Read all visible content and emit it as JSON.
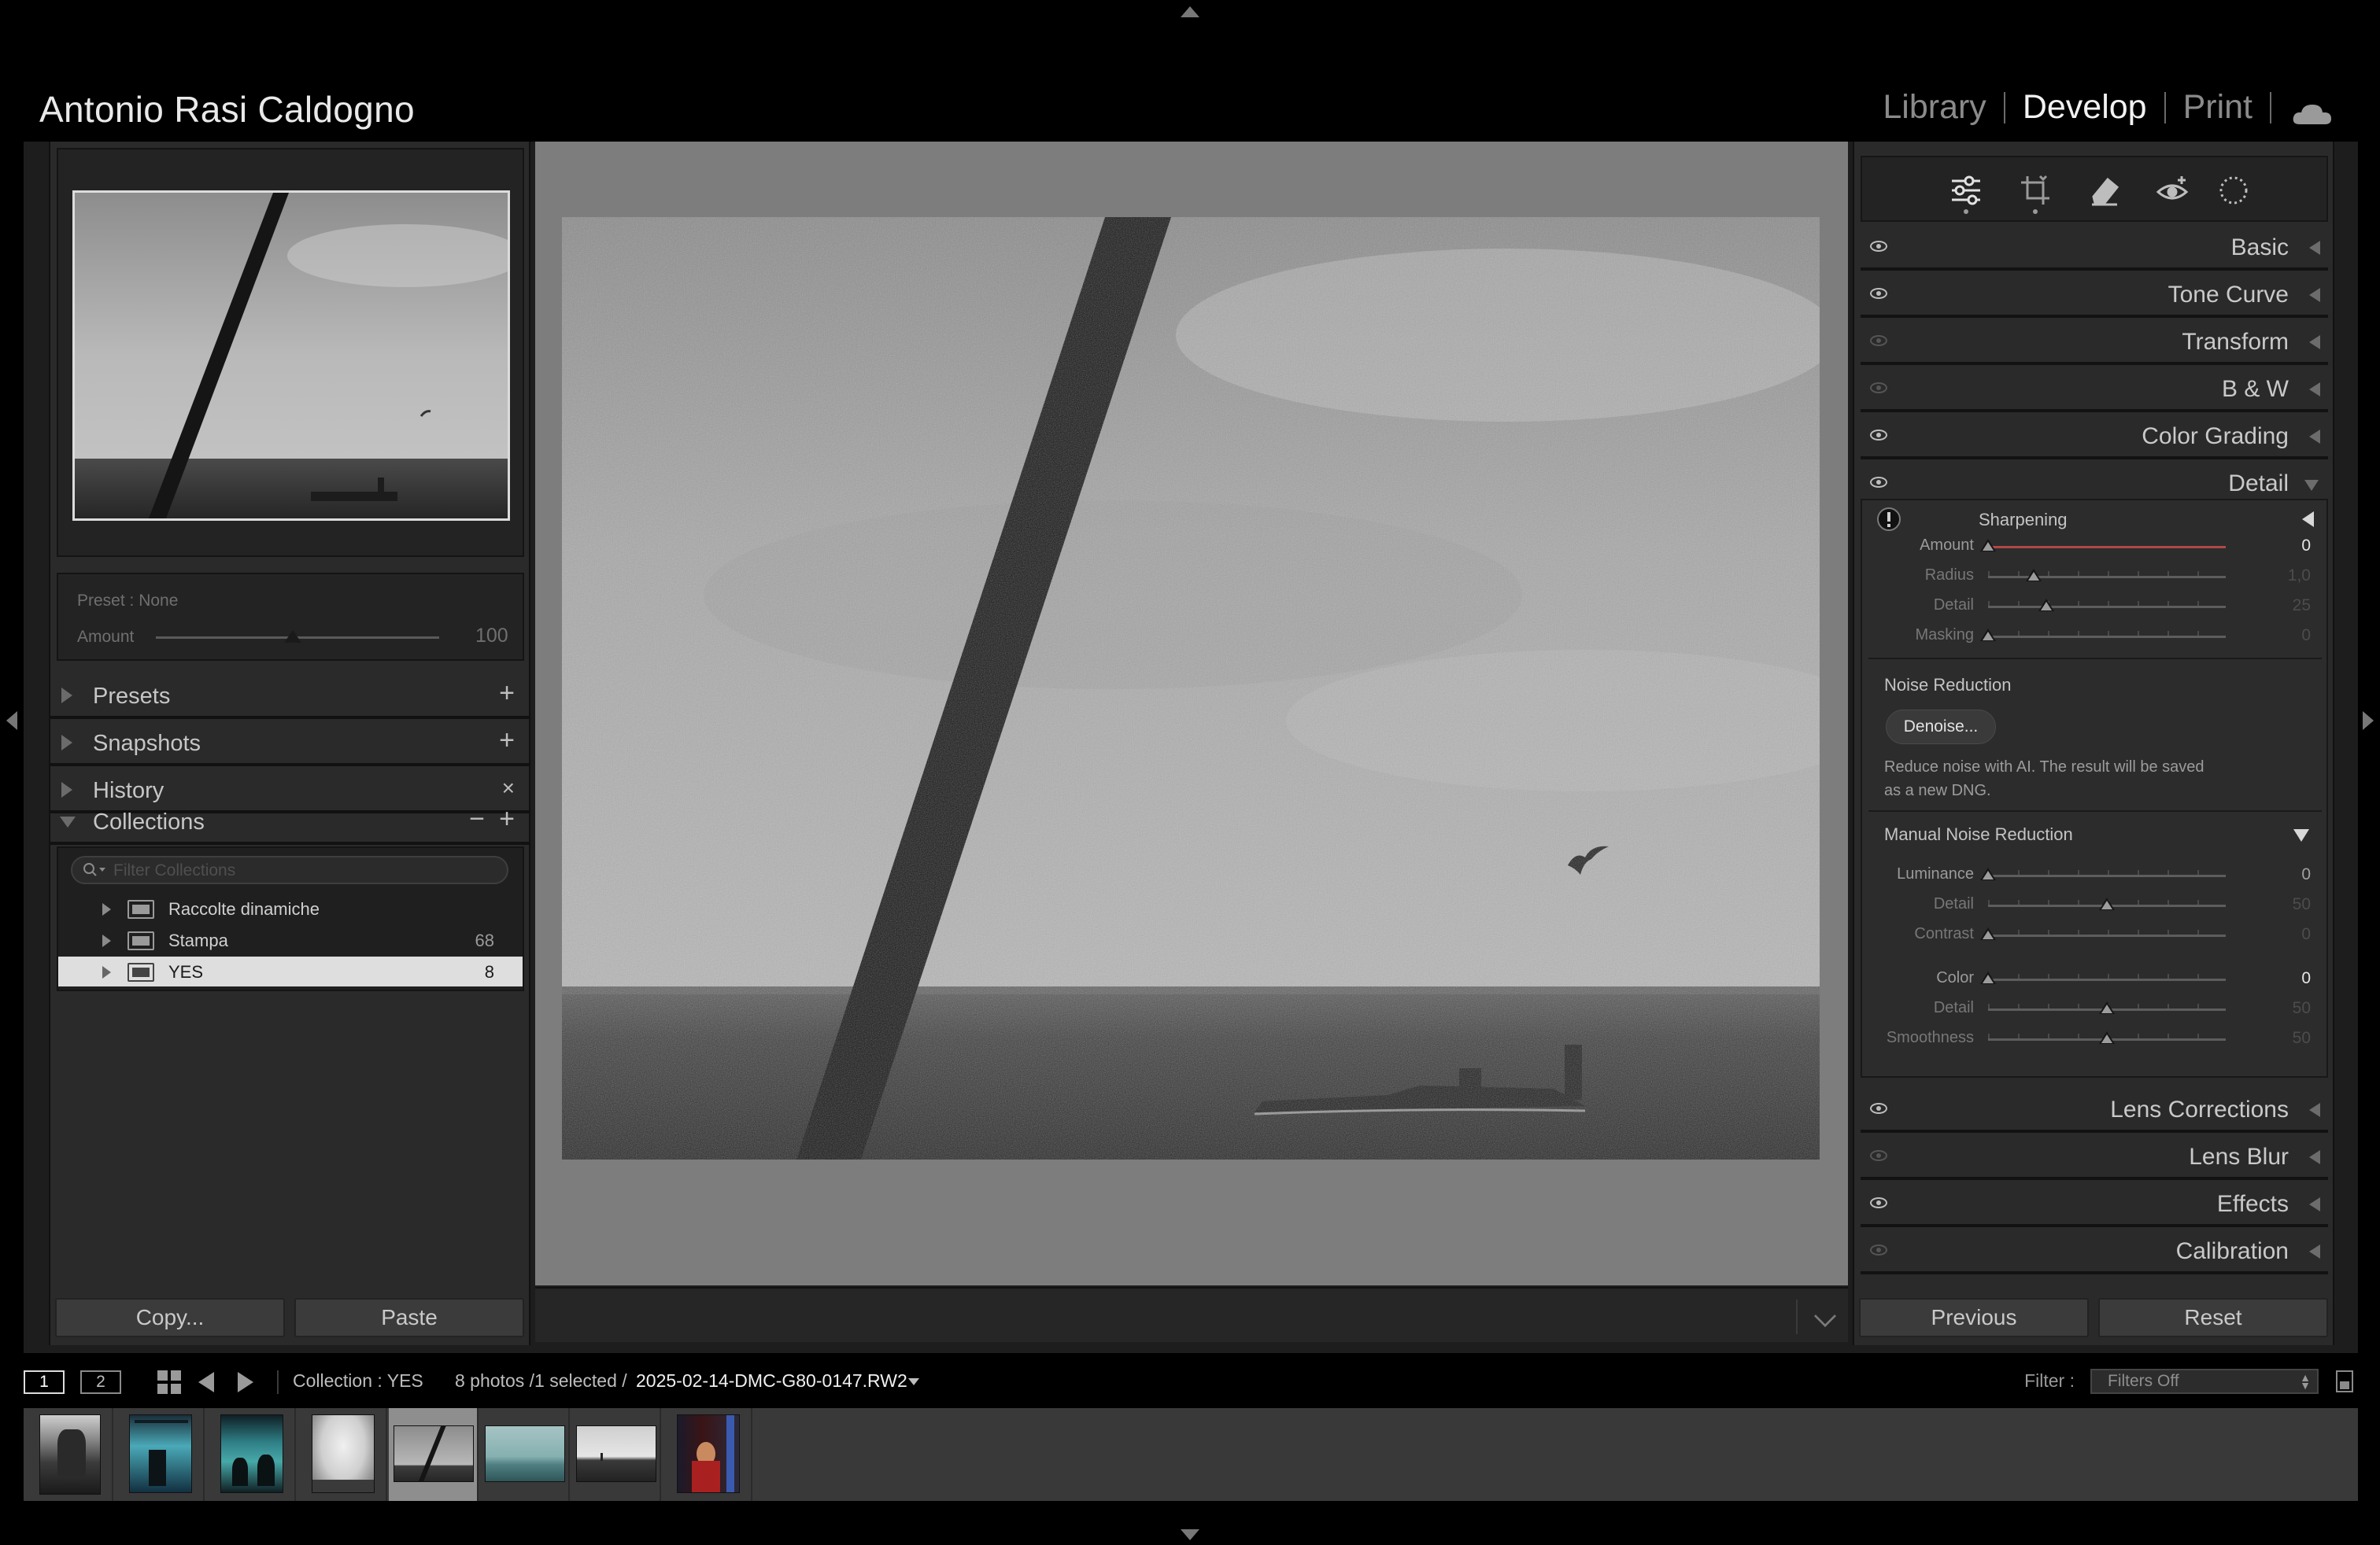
{
  "header": {
    "identity": "Antonio Rasi Caldogno",
    "modules": [
      {
        "label": "Library",
        "active": false
      },
      {
        "label": "Develop",
        "active": true
      },
      {
        "label": "Print",
        "active": false
      }
    ],
    "cloud_icon": "cloud-icon"
  },
  "left_panel": {
    "preset": {
      "label": "Preset : None",
      "amount_label": "Amount",
      "amount_value": "100"
    },
    "sections": {
      "presets": "Presets",
      "snapshots": "Snapshots",
      "history": "History",
      "collections": "Collections"
    },
    "collections": {
      "filter_placeholder": "Filter Collections",
      "items": [
        {
          "name": "Raccolte dinamiche",
          "count": ""
        },
        {
          "name": "Stampa",
          "count": "68"
        },
        {
          "name": "YES",
          "count": "8"
        }
      ]
    },
    "copy_button": "Copy...",
    "paste_button": "Paste"
  },
  "right_panel": {
    "tools": [
      "edit-sliders-icon",
      "crop-icon",
      "healing-eraser-icon",
      "red-eye-icon",
      "masking-icon"
    ],
    "panels": {
      "basic": "Basic",
      "tone_curve": "Tone Curve",
      "transform": "Transform",
      "bw": "B & W",
      "color_grading": "Color Grading",
      "detail": "Detail",
      "lens_corrections": "Lens Corrections",
      "lens_blur": "Lens Blur",
      "effects": "Effects",
      "calibration": "Calibration"
    },
    "detail": {
      "sharpening_title": "Sharpening",
      "sharpening": [
        {
          "label": "Amount",
          "value": "0",
          "pos": 0.0
        },
        {
          "label": "Radius",
          "value": "1,0",
          "pos": 0.2
        },
        {
          "label": "Detail",
          "value": "25",
          "pos": 0.25
        },
        {
          "label": "Masking",
          "value": "0",
          "pos": 0.0
        }
      ],
      "noise_reduction_title": "Noise Reduction",
      "denoise_button": "Denoise...",
      "denoise_text_1": "Reduce noise with AI. The result will be saved",
      "denoise_text_2": "as a new DNG.",
      "manual_nr_title": "Manual Noise Reduction",
      "luminance": [
        {
          "label": "Luminance",
          "value": "0",
          "pos": 0.0
        },
        {
          "label": "Detail",
          "value": "50",
          "pos": 0.5
        },
        {
          "label": "Contrast",
          "value": "0",
          "pos": 0.0
        }
      ],
      "color": [
        {
          "label": "Color",
          "value": "0",
          "pos": 0.0
        },
        {
          "label": "Detail",
          "value": "50",
          "pos": 0.5
        },
        {
          "label": "Smoothness",
          "value": "50",
          "pos": 0.5
        }
      ]
    },
    "previous_button": "Previous",
    "reset_button": "Reset"
  },
  "filmstrip_bar": {
    "screen1": "1",
    "screen2": "2",
    "source": "Collection : YES",
    "count_text": "8 photos /1 selected /",
    "filename": "2025-02-14-DMC-G80-0147.RW2",
    "filter_label": "Filter :",
    "filter_value": "Filters Off"
  },
  "filmstrip": {
    "selected_index": 4,
    "count": 8
  }
}
